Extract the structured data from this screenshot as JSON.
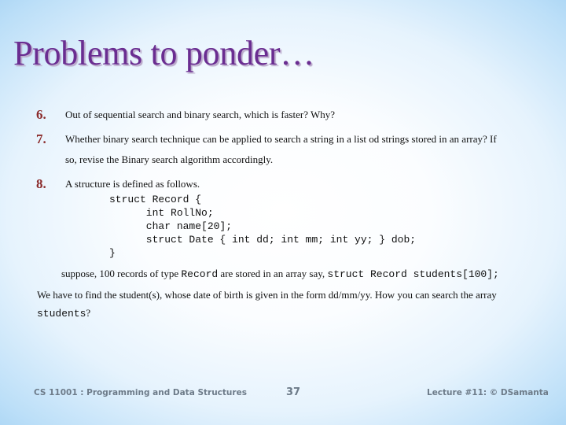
{
  "slide": {
    "title": "Problems to ponder",
    "title_ellipsis": "…",
    "items": [
      {
        "number": "6.",
        "text": "Out of sequential search and binary search, which is faster? Why?"
      },
      {
        "number": "7.",
        "text_line1": "Whether binary search technique can be applied to search a string in a list od strings stored in an array? If",
        "text_line2": "so, revise the Binary search algorithm accordingly."
      },
      {
        "number": "8.",
        "text": "A structure is defined as follows."
      }
    ],
    "code_lines": [
      "struct Record {",
      "      int RollNo;",
      "      char name[20];",
      "      struct Date { int dd; int mm; int yy; } dob;",
      "}"
    ],
    "suppose": {
      "part1": "suppose, 100 records of type ",
      "code1": "Record",
      "part2": " are stored in an array say, ",
      "code2": "struct Record students[100];"
    },
    "question": {
      "line1": "We have to find  the student(s), whose date of birth is given in the form dd/mm/yy. How you can search the array",
      "code": "students",
      "end": "?"
    }
  },
  "footer": {
    "course": "CS 11001 : Programming and Data Structures",
    "page": "37",
    "lecture": "Lecture #11: © DSamanta"
  },
  "colors": {
    "title": "#6a2d91",
    "numbers": "#8b2c2c",
    "footer": "#6d7b89"
  }
}
